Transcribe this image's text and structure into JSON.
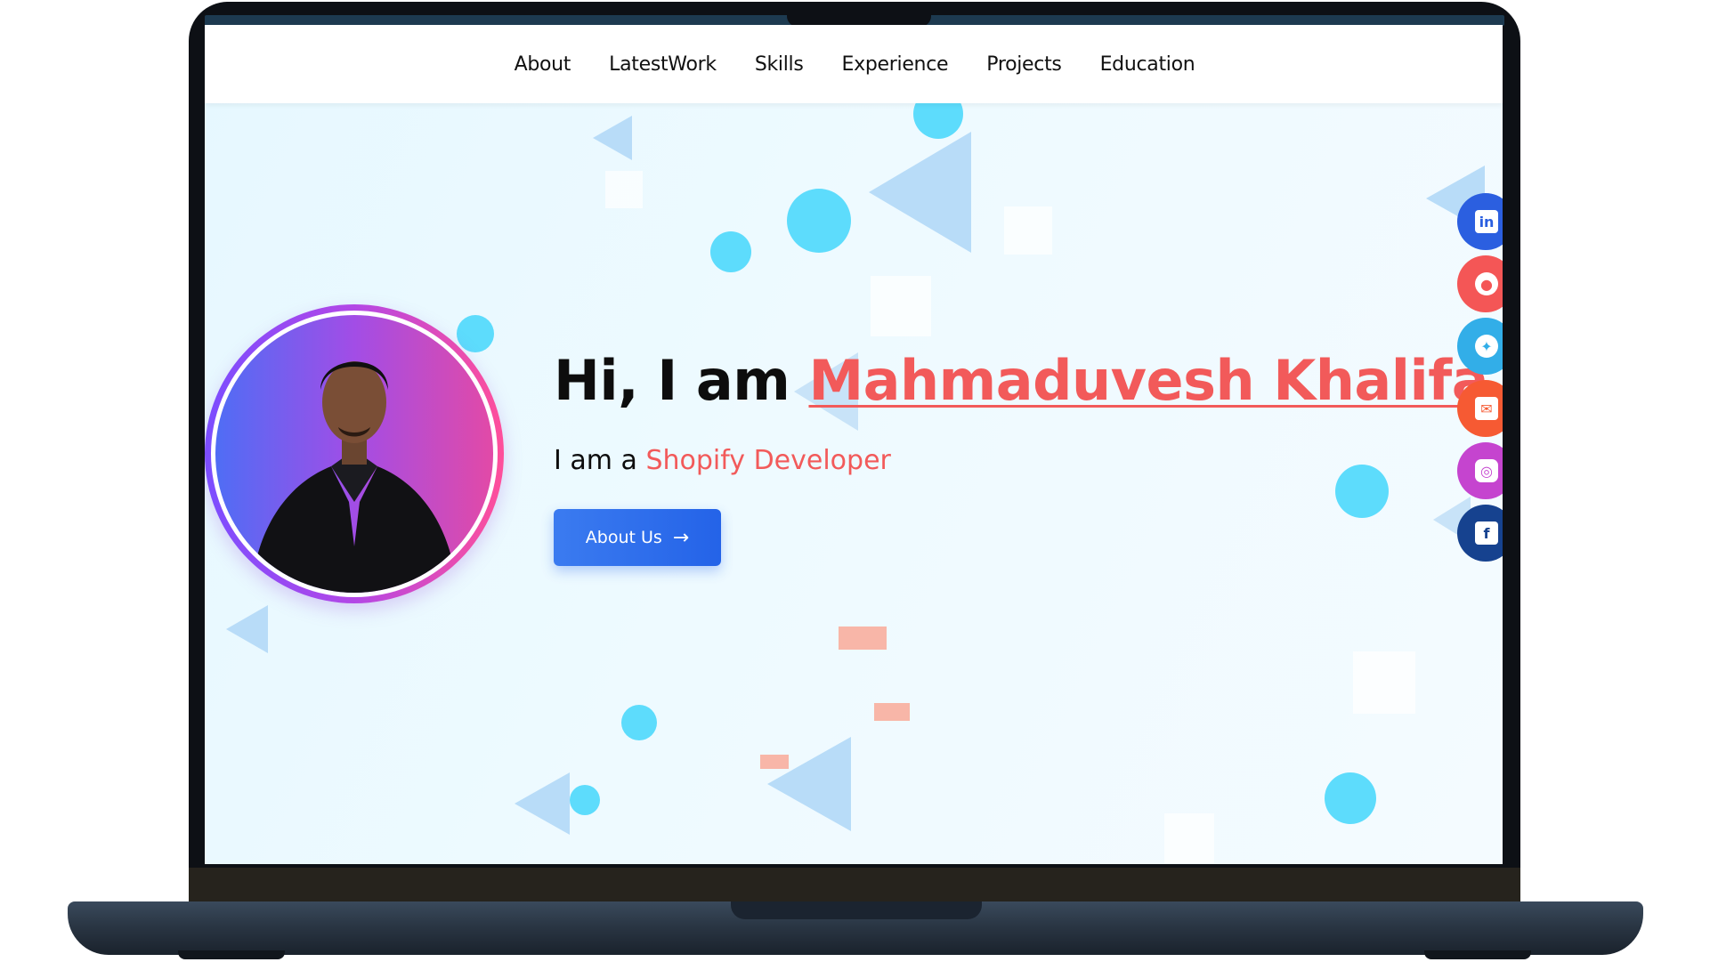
{
  "nav": {
    "items": [
      {
        "label": "About"
      },
      {
        "label": "LatestWork"
      },
      {
        "label": "Skills"
      },
      {
        "label": "Experience"
      },
      {
        "label": "Projects"
      },
      {
        "label": "Education"
      }
    ]
  },
  "hero": {
    "greeting": "Hi, I am",
    "name": "Mahmaduvesh Khalifa",
    "role_prefix": "I am a",
    "role": "Shopify Developer",
    "cta_label": "About Us",
    "cta_arrow": "→"
  },
  "social": [
    {
      "icon": "linkedin-icon",
      "color": "#2b5fe0",
      "glyph": "in"
    },
    {
      "icon": "github-icon",
      "color": "#f45656",
      "glyph": "●"
    },
    {
      "icon": "twitter-icon",
      "color": "#32aee8",
      "glyph": "✦"
    },
    {
      "icon": "mail-icon",
      "color": "#f65a33",
      "glyph": "✉"
    },
    {
      "icon": "instagram-icon",
      "color": "#c544cf",
      "glyph": "◎"
    },
    {
      "icon": "facebook-icon",
      "color": "#16428f",
      "glyph": "f"
    }
  ],
  "colors": {
    "accent": "#f25a5a",
    "button": "#2463e8",
    "dots": "#5ddcfc",
    "triangles": "#b8dcf8"
  }
}
